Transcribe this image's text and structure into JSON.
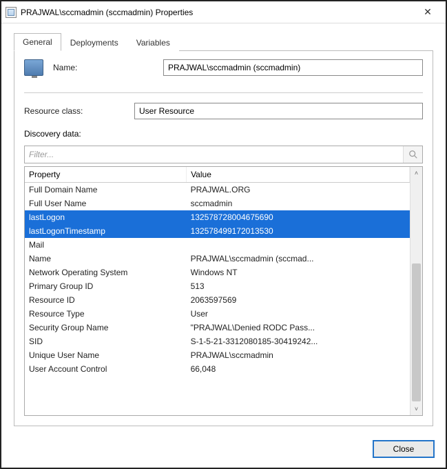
{
  "window": {
    "title": "PRAJWAL\\sccmadmin (sccmadmin) Properties"
  },
  "tabs": [
    {
      "label": "General",
      "active": true
    },
    {
      "label": "Deployments",
      "active": false
    },
    {
      "label": "Variables",
      "active": false
    }
  ],
  "general": {
    "name_label": "Name:",
    "name_value": "PRAJWAL\\sccmadmin (sccmadmin)",
    "resource_class_label": "Resource class:",
    "resource_class_value": "User Resource",
    "discovery_label": "Discovery data:"
  },
  "filter": {
    "placeholder": "Filter..."
  },
  "columns": {
    "property": "Property",
    "value": "Value"
  },
  "rows": [
    {
      "property": "Full Domain Name",
      "value": "PRAJWAL.ORG",
      "selected": false
    },
    {
      "property": "Full User Name",
      "value": "sccmadmin",
      "selected": false
    },
    {
      "property": "lastLogon",
      "value": "132578728004675690",
      "selected": true
    },
    {
      "property": "lastLogonTimestamp",
      "value": "132578499172013530",
      "selected": true
    },
    {
      "property": "Mail",
      "value": "",
      "selected": false
    },
    {
      "property": "Name",
      "value": "PRAJWAL\\sccmadmin (sccmad...",
      "selected": false
    },
    {
      "property": "Network Operating System",
      "value": "Windows NT",
      "selected": false
    },
    {
      "property": "Primary Group ID",
      "value": "513",
      "selected": false
    },
    {
      "property": "Resource ID",
      "value": "2063597569",
      "selected": false
    },
    {
      "property": "Resource Type",
      "value": "User",
      "selected": false
    },
    {
      "property": "Security Group Name",
      "value": "\"PRAJWAL\\Denied RODC Pass...",
      "selected": false
    },
    {
      "property": "SID",
      "value": "S-1-5-21-3312080185-30419242...",
      "selected": false
    },
    {
      "property": "Unique User Name",
      "value": "PRAJWAL\\sccmadmin",
      "selected": false
    },
    {
      "property": "User Account Control",
      "value": "66,048",
      "selected": false
    }
  ],
  "footer": {
    "close_label": "Close"
  }
}
